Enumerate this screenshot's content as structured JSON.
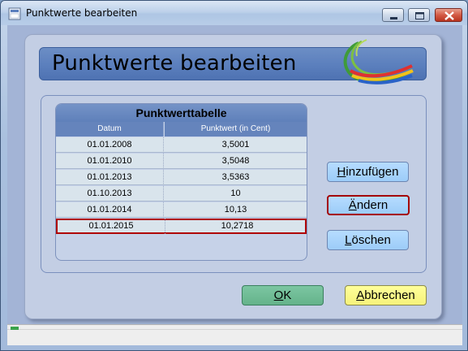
{
  "window": {
    "title": "Punktwerte bearbeiten"
  },
  "header": {
    "title": "Punktwerte bearbeiten"
  },
  "table": {
    "caption": "Punktwerttabelle",
    "columns": [
      "Datum",
      "Punktwert (in Cent)"
    ],
    "rows": [
      {
        "date": "01.01.2008",
        "value": "3,5001"
      },
      {
        "date": "01.01.2010",
        "value": "3,5048"
      },
      {
        "date": "01.01.2013",
        "value": "3,5363"
      },
      {
        "date": "01.10.2013",
        "value": "10"
      },
      {
        "date": "01.01.2014",
        "value": "10,13"
      },
      {
        "date": "01.01.2015",
        "value": "10,2718"
      }
    ],
    "selected_index": 5
  },
  "buttons": {
    "add": {
      "accel": "H",
      "rest": "inzufügen"
    },
    "edit": {
      "accel": "Ä",
      "rest": "ndern"
    },
    "delete": {
      "accel": "L",
      "rest": "öschen"
    },
    "ok": {
      "accel": "O",
      "rest": "K"
    },
    "cancel": {
      "accel": "A",
      "rest": "bbrechen"
    }
  },
  "colors": {
    "header": "#5b7fbd",
    "selection_border": "#b00000",
    "button_blue": "#9cccf8",
    "button_ok": "#65b38b",
    "button_cancel": "#f6f27a"
  }
}
